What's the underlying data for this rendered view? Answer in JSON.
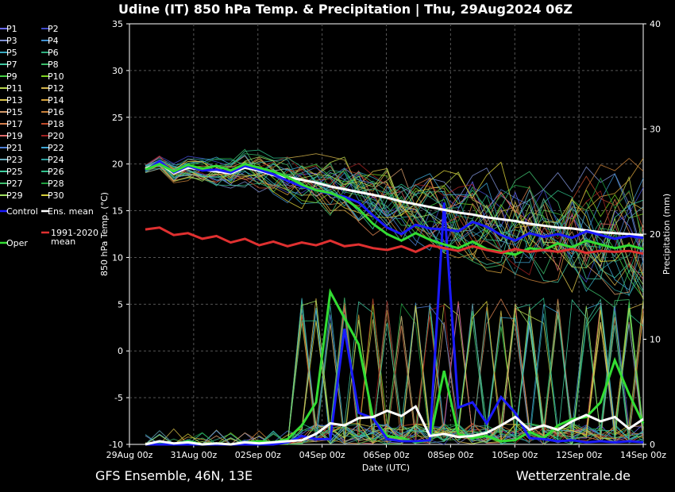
{
  "chart_data": {
    "type": "line",
    "title": "Udine  (IT)  850 hPa Temp. & Precipitation | Thu, 29Aug2024 06Z",
    "ylabel": "850 hPa Temp. (°C)",
    "y2label": "Precipitation (mm)",
    "xlabel": "Date (UTC)",
    "ylim": [
      -10,
      35
    ],
    "y2lim": [
      0,
      40
    ],
    "yticks": [
      "35",
      "30",
      "25",
      "20",
      "15",
      "10",
      "5",
      "0",
      "-5",
      "-10"
    ],
    "y2ticks": [
      "40",
      "30",
      "20",
      "10",
      "0"
    ],
    "xticks": [
      "29Aug 00z",
      "31Aug 00z",
      "02Sep 00z",
      "04Sep 00z",
      "06Sep 00z",
      "08Sep 00z",
      "10Sep 00z",
      "12Sep 00z",
      "14Sep 00z"
    ],
    "grid": true,
    "legend_position": "left",
    "footer_left": "GFS Ensemble, 46N, 13E",
    "footer_right": "Wetterzentrale.de",
    "members": [
      {
        "name": "P1",
        "color": "#6a6aff"
      },
      {
        "name": "P2",
        "color": "#3f49c9"
      },
      {
        "name": "P3",
        "color": "#7d8fd3"
      },
      {
        "name": "P4",
        "color": "#3f8fd0"
      },
      {
        "name": "P5",
        "color": "#37a9c0"
      },
      {
        "name": "P6",
        "color": "#2fb07f"
      },
      {
        "name": "P7",
        "color": "#3fc6a0"
      },
      {
        "name": "P8",
        "color": "#3bbd6a"
      },
      {
        "name": "P9",
        "color": "#44d044"
      },
      {
        "name": "P10",
        "color": "#7ed321"
      },
      {
        "name": "P11",
        "color": "#b7d34a"
      },
      {
        "name": "P12",
        "color": "#d3b34a"
      },
      {
        "name": "P13",
        "color": "#d8c24a"
      },
      {
        "name": "P14",
        "color": "#d3a03a"
      },
      {
        "name": "P15",
        "color": "#d39a6a"
      },
      {
        "name": "P16",
        "color": "#c9813a"
      },
      {
        "name": "P17",
        "color": "#d57f4d"
      },
      {
        "name": "P18",
        "color": "#c04a2a"
      },
      {
        "name": "P19",
        "color": "#e06a6a"
      },
      {
        "name": "P20",
        "color": "#a02020"
      },
      {
        "name": "P21",
        "color": "#4f7fd6"
      },
      {
        "name": "P22",
        "color": "#3fa7d6"
      },
      {
        "name": "P23",
        "color": "#6ab0c0"
      },
      {
        "name": "P24",
        "color": "#2f9f9f"
      },
      {
        "name": "P25",
        "color": "#3fd0a0"
      },
      {
        "name": "P26",
        "color": "#2fc08a"
      },
      {
        "name": "P27",
        "color": "#40c070"
      },
      {
        "name": "P28",
        "color": "#1f9f3f"
      },
      {
        "name": "P29",
        "color": "#a0e060"
      },
      {
        "name": "P30",
        "color": "#d8d03a"
      }
    ],
    "legend_extra": [
      {
        "name": "Control",
        "color": "#1a1aff"
      },
      {
        "name": "Ens. mean",
        "color": "#ffffff"
      },
      {
        "name": "1991-2020 mean",
        "lines": [
          "1991-2020",
          "mean"
        ],
        "color": "#e03030"
      },
      {
        "name": "Oper",
        "color": "#33dd33"
      }
    ],
    "series": [
      {
        "name": "Ens. mean",
        "color": "#ffffff",
        "values": [
          19.5,
          20.1,
          19.0,
          19.6,
          19.4,
          19.2,
          19.0,
          19.6,
          19.3,
          18.8,
          18.6,
          18.3,
          18.0,
          17.6,
          17.3,
          17.0,
          16.7,
          16.4,
          16.0,
          15.7,
          15.4,
          15.1,
          14.8,
          14.6,
          14.3,
          14.1,
          13.9,
          13.6,
          13.4,
          13.2,
          13.1,
          12.9,
          12.7,
          12.6,
          12.5,
          12.4
        ]
      },
      {
        "name": "Control",
        "color": "#1a1aff",
        "values": [
          19.3,
          20.3,
          19.1,
          19.8,
          19.3,
          19.4,
          19.1,
          19.8,
          19.4,
          18.9,
          18.2,
          17.6,
          17.2,
          16.8,
          16.5,
          15.9,
          14.5,
          13.2,
          12.5,
          13.5,
          13.1,
          13.0,
          12.8,
          13.8,
          13.3,
          12.4,
          11.8,
          12.6,
          12.2,
          12.5,
          12.1,
          12.8,
          12.4,
          12.0,
          12.3,
          12.1
        ]
      },
      {
        "name": "Oper",
        "color": "#33dd33",
        "values": [
          19.4,
          20.0,
          19.2,
          19.9,
          19.5,
          19.8,
          19.3,
          20.0,
          19.6,
          19.2,
          18.6,
          17.8,
          17.2,
          16.9,
          16.3,
          15.2,
          13.6,
          12.5,
          11.8,
          12.6,
          11.9,
          11.4,
          11.0,
          11.7,
          10.9,
          10.6,
          10.3,
          11.0,
          10.8,
          11.5,
          11.1,
          11.8,
          11.4,
          11.0,
          11.3,
          10.9
        ]
      },
      {
        "name": "1991-2020 mean",
        "color": "#e03030",
        "values": [
          13.0,
          13.2,
          12.4,
          12.6,
          12.0,
          12.3,
          11.6,
          12.0,
          11.3,
          11.7,
          11.2,
          11.6,
          11.3,
          11.8,
          11.2,
          11.4,
          11.0,
          10.8,
          11.2,
          10.6,
          11.3,
          11.0,
          10.7,
          11.2,
          10.8,
          10.5,
          10.9,
          10.6,
          10.8,
          10.6,
          10.9,
          10.5,
          10.7,
          10.6,
          10.7,
          10.4
        ]
      }
    ],
    "precip_series": [
      {
        "name": "Oper",
        "color": "#33dd33",
        "values": [
          0,
          0.2,
          0,
          0.3,
          0,
          0.1,
          0,
          0.2,
          0.3,
          0.2,
          0.5,
          1.8,
          4.0,
          14.5,
          12.0,
          9.5,
          2.5,
          0.8,
          0.6,
          0.2,
          0.4,
          7.0,
          1.0,
          0.6,
          0.8,
          0.3,
          0.4,
          1.2,
          0.6,
          1.8,
          2.4,
          2.6,
          4.0,
          8.0,
          4.8,
          2.0
        ]
      },
      {
        "name": "Control",
        "color": "#1a1aff",
        "values": [
          0,
          0,
          0,
          0,
          0,
          0,
          0,
          0,
          0,
          0,
          0.2,
          0.8,
          0.5,
          0.5,
          11.0,
          3.0,
          2.5,
          0.5,
          0.3,
          0.3,
          0.4,
          23.0,
          3.5,
          4.0,
          2.0,
          4.5,
          3.0,
          0.6,
          0.5,
          0.3,
          0.4,
          0.2,
          0.3,
          0.2,
          0.3,
          0.2
        ]
      },
      {
        "name": "Ens. mean",
        "color": "#ffffff",
        "values": [
          0,
          0.3,
          0.1,
          0.2,
          0,
          0.1,
          0,
          0.2,
          0.1,
          0.2,
          0.3,
          0.4,
          1.0,
          2.0,
          1.8,
          2.5,
          2.6,
          3.2,
          2.7,
          3.6,
          0.8,
          1.0,
          0.7,
          0.8,
          1.1,
          1.8,
          2.6,
          1.4,
          1.8,
          1.4,
          2.2,
          2.8,
          2.2,
          2.6,
          1.5,
          2.4
        ]
      }
    ]
  }
}
